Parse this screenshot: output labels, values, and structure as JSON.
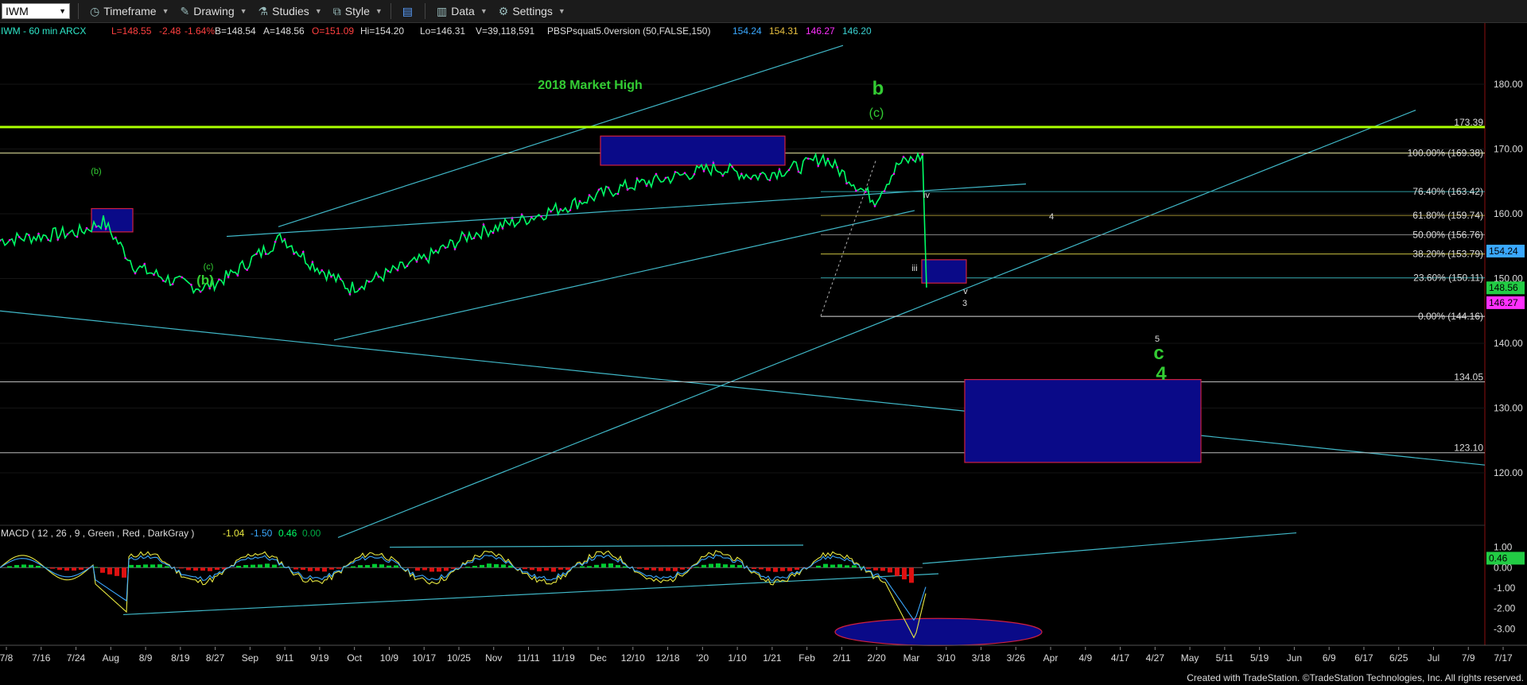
{
  "toolbar": {
    "symbol": "IWM",
    "timeframe": "Timeframe",
    "drawing": "Drawing",
    "studies": "Studies",
    "style": "Style",
    "data": "Data",
    "settings": "Settings"
  },
  "header": {
    "title": "IWM - 60 min  ARCX",
    "last": "L=148.55",
    "change": "-2.48",
    "pct": "-1.64%",
    "bid": "B=148.54",
    "ask": "A=148.56",
    "open": "O=151.09",
    "high": "Hi=154.20",
    "low": "Lo=146.31",
    "volume": "V=39,118,591",
    "study": "PBSPsquat5.0version (50,FALSE,150)",
    "v1": "154.24",
    "v2": "154.31",
    "v3": "146.27",
    "v4": "146.20"
  },
  "price_axis": {
    "ticks": [
      "180.00",
      "170.00",
      "160.00",
      "150.00",
      "140.00",
      "130.00",
      "120.00"
    ],
    "tags": {
      "blue": "154.24",
      "green": "148.56",
      "magenta": "146.27"
    }
  },
  "levels": {
    "market_high": "173.39",
    "fib_100": "100.00% (169.38)",
    "fib_100_price": "169.38",
    "fib_76": "76.40% (163.42)",
    "fib_618": "61.80% (159.74)",
    "fib_50": "50.00% (156.76)",
    "fib_382": "38.20% (153.79)",
    "fib_236": "23.60% (150.11)",
    "fib_0": "0.00% (144.16)",
    "l134": "134.05",
    "l123": "123.10"
  },
  "annotations": {
    "market_high": "2018 Market High",
    "b_big": "b",
    "c_paren": "(c)",
    "b_paren_small": "(b)",
    "c_paren_small": "(c)",
    "b_paren_big": "(b)",
    "iii": "iii",
    "iv": "iv",
    "v": "v",
    "three": "3",
    "four": "4",
    "five": "5",
    "c_big": "c",
    "four_big": "4"
  },
  "macd": {
    "label": "MACD ( 12 , 26 , 9 , Green , Red , DarkGray )",
    "v1": "-1.04",
    "v2": "-1.50",
    "v3": "0.46",
    "v4": "0.00",
    "ticks": [
      "1.00",
      "0.00",
      "-1.00",
      "-2.00",
      "-3.00"
    ],
    "tag": "0.46"
  },
  "x_axis": [
    "7/8",
    "7/16",
    "7/24",
    "Aug",
    "8/9",
    "8/19",
    "8/27",
    "Sep",
    "9/11",
    "9/19",
    "Oct",
    "10/9",
    "10/17",
    "10/25",
    "Nov",
    "11/11",
    "11/19",
    "Dec",
    "12/10",
    "12/18",
    "'20",
    "1/10",
    "1/21",
    "Feb",
    "2/11",
    "2/20",
    "Mar",
    "3/10",
    "3/18",
    "3/26",
    "Apr",
    "4/9",
    "4/17",
    "4/27",
    "May",
    "5/11",
    "5/19",
    "Jun",
    "6/9",
    "6/17",
    "6/25",
    "Jul",
    "7/9",
    "7/17"
  ],
  "footer": "Created with TradeStation. ©TradeStation Technologies, Inc. All rights reserved.",
  "colors": {
    "up": "#00ff66",
    "down": "#ff00ff",
    "wave": "#33cc33",
    "trend": "#40b8c8",
    "box_fill": "#0a0a88",
    "box_border": "#d02040",
    "market_high_line": "#aaff00"
  },
  "chart_data": {
    "type": "line",
    "title": "IWM - 60 min",
    "ylim": [
      113,
      187
    ],
    "x": [
      "7/8",
      "7/24",
      "Aug",
      "8/9",
      "8/19",
      "8/27",
      "Sep",
      "9/11",
      "9/19",
      "Oct",
      "10/9",
      "10/25",
      "Nov",
      "11/19",
      "Dec",
      "12/10",
      "12/18",
      "'20",
      "1/10",
      "1/21",
      "Feb",
      "2/11",
      "2/20",
      "Mar"
    ],
    "series": [
      {
        "values": [
          155.9,
          157.2,
          158.8,
          151.8,
          149.5,
          148.5,
          150.5,
          156.4,
          152.5,
          148.5,
          152.8,
          156.7,
          158.8,
          161.5,
          164.0,
          165.5,
          167.1,
          165.8,
          167.4,
          168.8,
          162.1,
          167.7,
          168.9,
          148.6
        ]
      }
    ],
    "macd_ylim": [
      -3.8,
      1.8
    ]
  }
}
